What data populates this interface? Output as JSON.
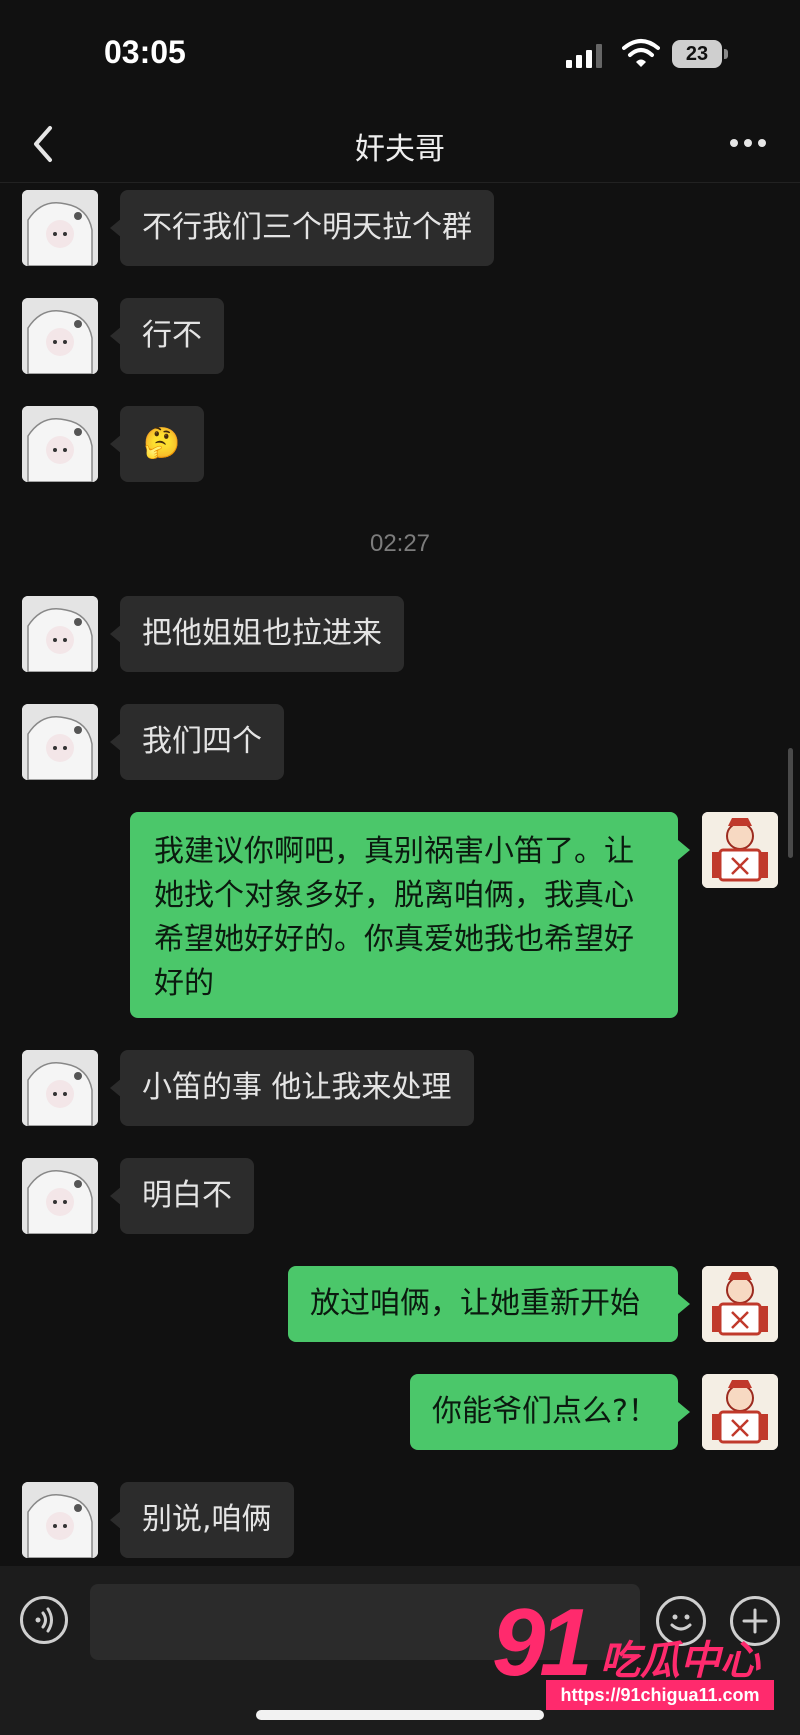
{
  "status_bar": {
    "time": "03:05",
    "battery": "23"
  },
  "nav": {
    "title": "奸夫哥"
  },
  "messages": {
    "m1": "不行我们三个明天拉个群",
    "m2": "行不",
    "m3": "🤔",
    "timestamp": "02:27",
    "m4": "把他姐姐也拉进来",
    "m5": "我们四个",
    "m6": "我建议你啊吧，真别祸害小笛了。让她找个对象多好，脱离咱俩，我真心希望她好好的。你真爱她我也希望好好的",
    "m7": "小笛的事 他让我来处理",
    "m8": "明白不",
    "m9": "放过咱俩，让她重新开始",
    "m10": "你能爷们点么?！",
    "m11": "别说,咱俩"
  },
  "watermark": {
    "number": "91",
    "text": "吃瓜中心",
    "url": "https://91chigua11.com"
  },
  "colors": {
    "background": "#111111",
    "incoming_bubble": "#2c2c2c",
    "outgoing_bubble": "#4bc76a",
    "watermark": "#ff2a6d"
  }
}
